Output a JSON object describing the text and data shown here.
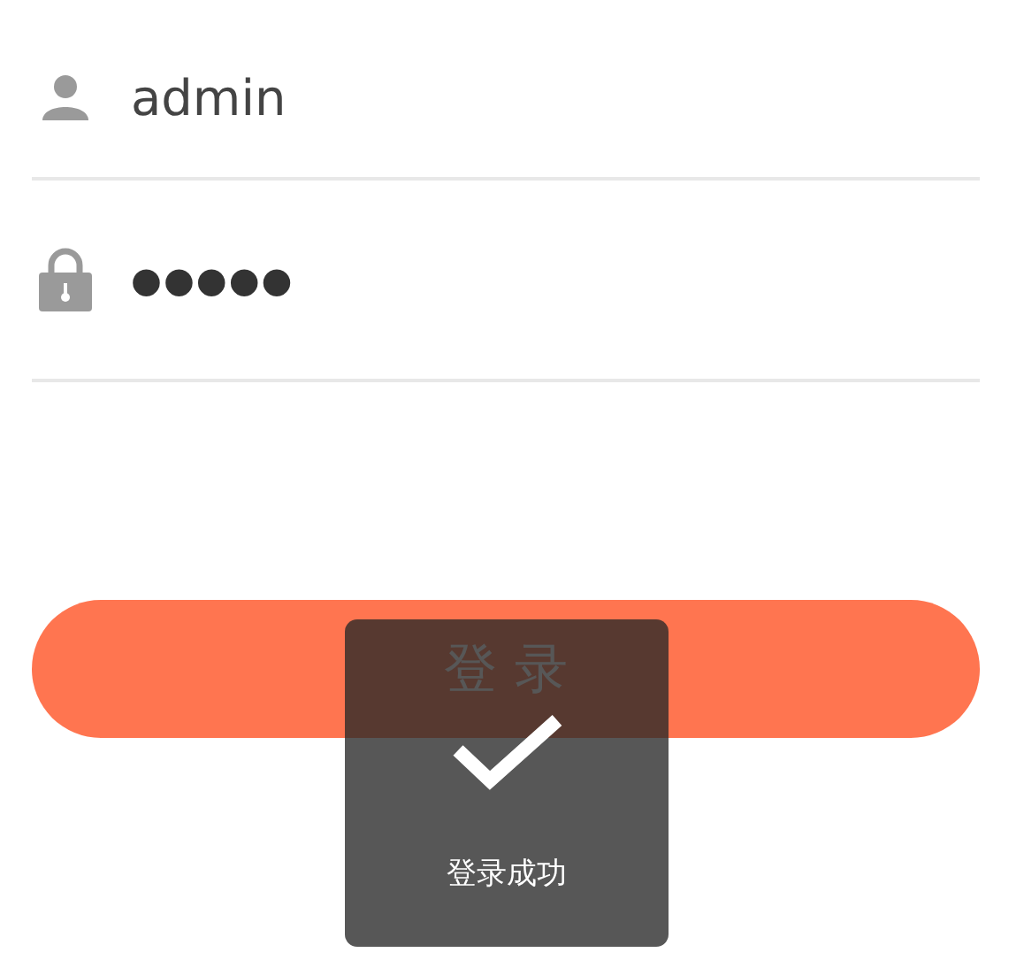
{
  "fields": [
    {
      "kind": "user",
      "value": "admin"
    },
    {
      "kind": "lock",
      "value": "●●●●●"
    }
  ],
  "login_button": {
    "label": "登 录"
  },
  "toast": {
    "kind": "success",
    "message": "登录成功"
  }
}
